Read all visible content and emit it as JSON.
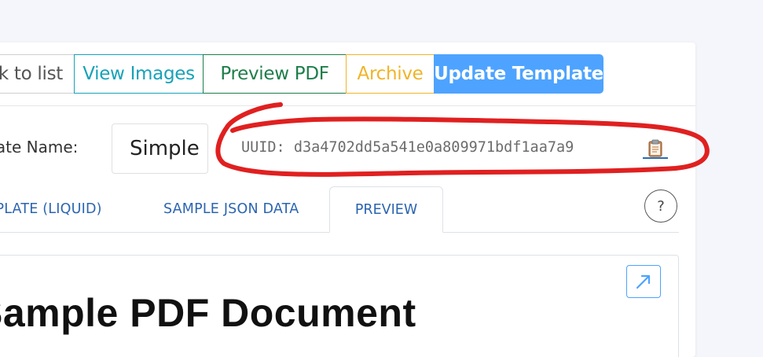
{
  "toolbar": {
    "back_label": "Back to list",
    "view_images_label": "View Images",
    "preview_pdf_label": "Preview PDF",
    "archive_label": "Archive",
    "update_label": "Update Template"
  },
  "form": {
    "name_label": "Template Name:",
    "name_value": "Simple"
  },
  "uuid": {
    "text": "UUID: d3a4702dd5a541e0a809971bdf1aa7a9",
    "copy_icon": "clipboard-icon"
  },
  "tabs": [
    {
      "label": "TEMPLATE (LIQUID)"
    },
    {
      "label": "SAMPLE JSON DATA"
    },
    {
      "label": "PREVIEW",
      "active": true
    }
  ],
  "help": {
    "label": "?"
  },
  "preview": {
    "title": "Sample PDF Document",
    "expand_icon": "expand-arrow-icon"
  },
  "colors": {
    "info": "#17a2b8",
    "success": "#1e7e4a",
    "warning": "#f0b429",
    "primary": "#4da3ff",
    "annotation": "#e02020"
  }
}
